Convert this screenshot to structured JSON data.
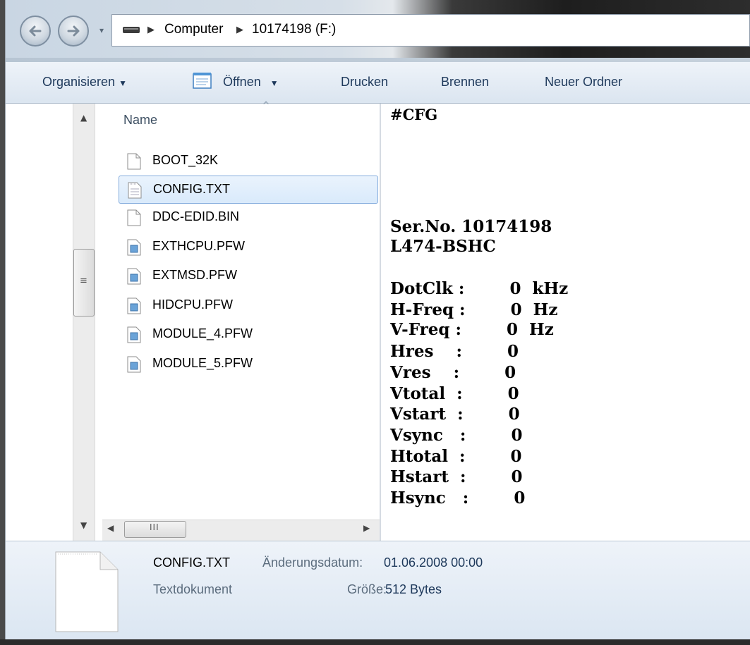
{
  "address": {
    "crumbs": [
      "Computer",
      "10174198 (F:)"
    ]
  },
  "toolbar": {
    "organize": "Organisieren",
    "open": "Öffnen",
    "print": "Drucken",
    "burn": "Brennen",
    "new_folder": "Neuer Ordner"
  },
  "filelist": {
    "column_name": "Name",
    "files": [
      {
        "name": "BOOT_32K",
        "icon": "blank-file-icon"
      },
      {
        "name": "CONFIG.TXT",
        "icon": "text-file-icon",
        "selected": true
      },
      {
        "name": "DDC-EDID.BIN",
        "icon": "blank-file-icon"
      },
      {
        "name": "EXTHCPU.PFW",
        "icon": "firmware-file-icon"
      },
      {
        "name": "EXTMSD.PFW",
        "icon": "firmware-file-icon"
      },
      {
        "name": "HIDCPU.PFW",
        "icon": "firmware-file-icon"
      },
      {
        "name": "MODULE_4.PFW",
        "icon": "firmware-file-icon"
      },
      {
        "name": "MODULE_5.PFW",
        "icon": "firmware-file-icon"
      }
    ]
  },
  "preview": {
    "header": "#CFG",
    "serial": "Ser.No. 10174198",
    "model": "L474-BSHC",
    "params": [
      "DotClk :        0  kHz",
      "H-Freq :        0  Hz",
      "V-Freq :        0  Hz",
      "Hres    :        0",
      "Vres    :        0",
      "Vtotal  :        0",
      "Vstart  :        0",
      "Vsync   :        0",
      "Htotal  :        0",
      "Hstart  :        0",
      "Hsync   :        0"
    ]
  },
  "details": {
    "filename": "CONFIG.TXT",
    "type": "Textdokument",
    "modified_label": "Änderungsdatum:",
    "modified_value": "01.06.2008 00:00",
    "size_label": "Größe:",
    "size_value": "512 Bytes"
  }
}
